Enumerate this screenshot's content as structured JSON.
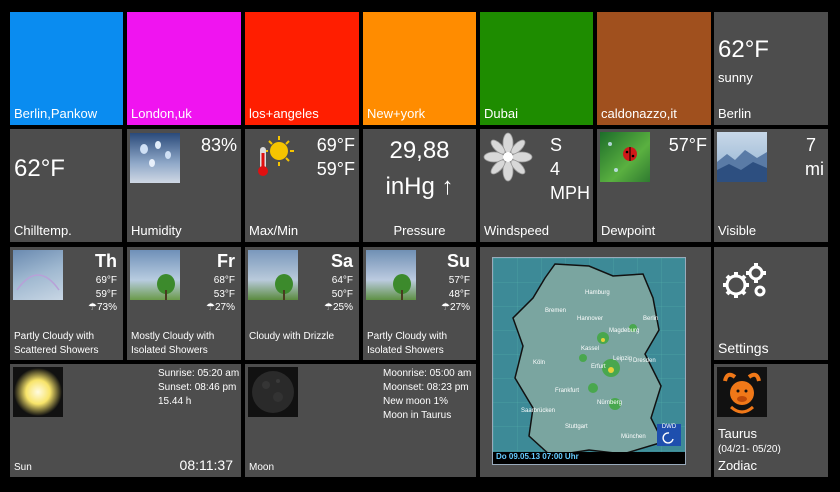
{
  "cities": [
    {
      "name": "Berlin,Pankow",
      "color": "#0a8cf0"
    },
    {
      "name": "London,uk",
      "color": "#f014f0"
    },
    {
      "name": "los+angeles",
      "color": "#ff1e00"
    },
    {
      "name": "New+york",
      "color": "#ff8c00"
    },
    {
      "name": "Dubai",
      "color": "#1e8c00"
    },
    {
      "name": "caldonazzo,it",
      "color": "#a0501e"
    }
  ],
  "current": {
    "temp": "62°F",
    "condition": "sunny",
    "city": "Berlin"
  },
  "chill": {
    "temp": "62°F",
    "label": "Chilltemp."
  },
  "humidity": {
    "value": "83%",
    "label": "Humidity"
  },
  "maxmin": {
    "max": "69°F",
    "min": "59°F",
    "label": "Max/Min"
  },
  "pressure": {
    "value": "29,88",
    "unit": "inHg ↑",
    "label": "Pressure"
  },
  "wind": {
    "dir": "S",
    "speed": "4",
    "unit": "MPH",
    "label": "Windspeed"
  },
  "dewpoint": {
    "value": "57°F",
    "label": "Dewpoint"
  },
  "visible": {
    "value": "7",
    "unit": "mi",
    "label": "Visible"
  },
  "forecast": [
    {
      "day": "Th",
      "hi": "69°F",
      "lo": "59°F",
      "rain": "☂73%",
      "desc1": "Partly Cloudy with",
      "desc2": "Scattered Showers"
    },
    {
      "day": "Fr",
      "hi": "68°F",
      "lo": "53°F",
      "rain": "☂27%",
      "desc1": "Mostly Cloudy with",
      "desc2": "Isolated Showers"
    },
    {
      "day": "Sa",
      "hi": "64°F",
      "lo": "50°F",
      "rain": "☂25%",
      "desc1": "Cloudy with Drizzle",
      "desc2": ""
    },
    {
      "day": "Su",
      "hi": "57°F",
      "lo": "48°F",
      "rain": "☂27%",
      "desc1": "Partly Cloudy with",
      "desc2": "Isolated Showers"
    }
  ],
  "map": {
    "caption": "Do 09.05.13 07:00 Uhr",
    "logo": "DWD",
    "cities": [
      "Hamburg",
      "Bremen",
      "Hannover",
      "Berlin",
      "Dresden",
      "Leipzig",
      "Kassel",
      "Köln",
      "Frankfurt",
      "Nürnberg",
      "München",
      "Stuttgart",
      "Saarbrücken",
      "Magdeburg",
      "Erfurt"
    ]
  },
  "settings": {
    "label": "Settings"
  },
  "sun": {
    "sunrise": "Sunrise: 05:20 am",
    "sunset": "Sunset: 08:46 pm",
    "daylength": "15.44 h",
    "time": "08:11:37",
    "label": "Sun"
  },
  "moon": {
    "moonrise": "Moonrise: 05:00 am",
    "moonset": "Moonset: 08:23 pm",
    "phase": "New moon 1%",
    "sign": "Moon in Taurus",
    "label": "Moon"
  },
  "zodiac": {
    "name": "Taurus",
    "range": "(04/21- 05/20)",
    "label": "Zodiac"
  }
}
